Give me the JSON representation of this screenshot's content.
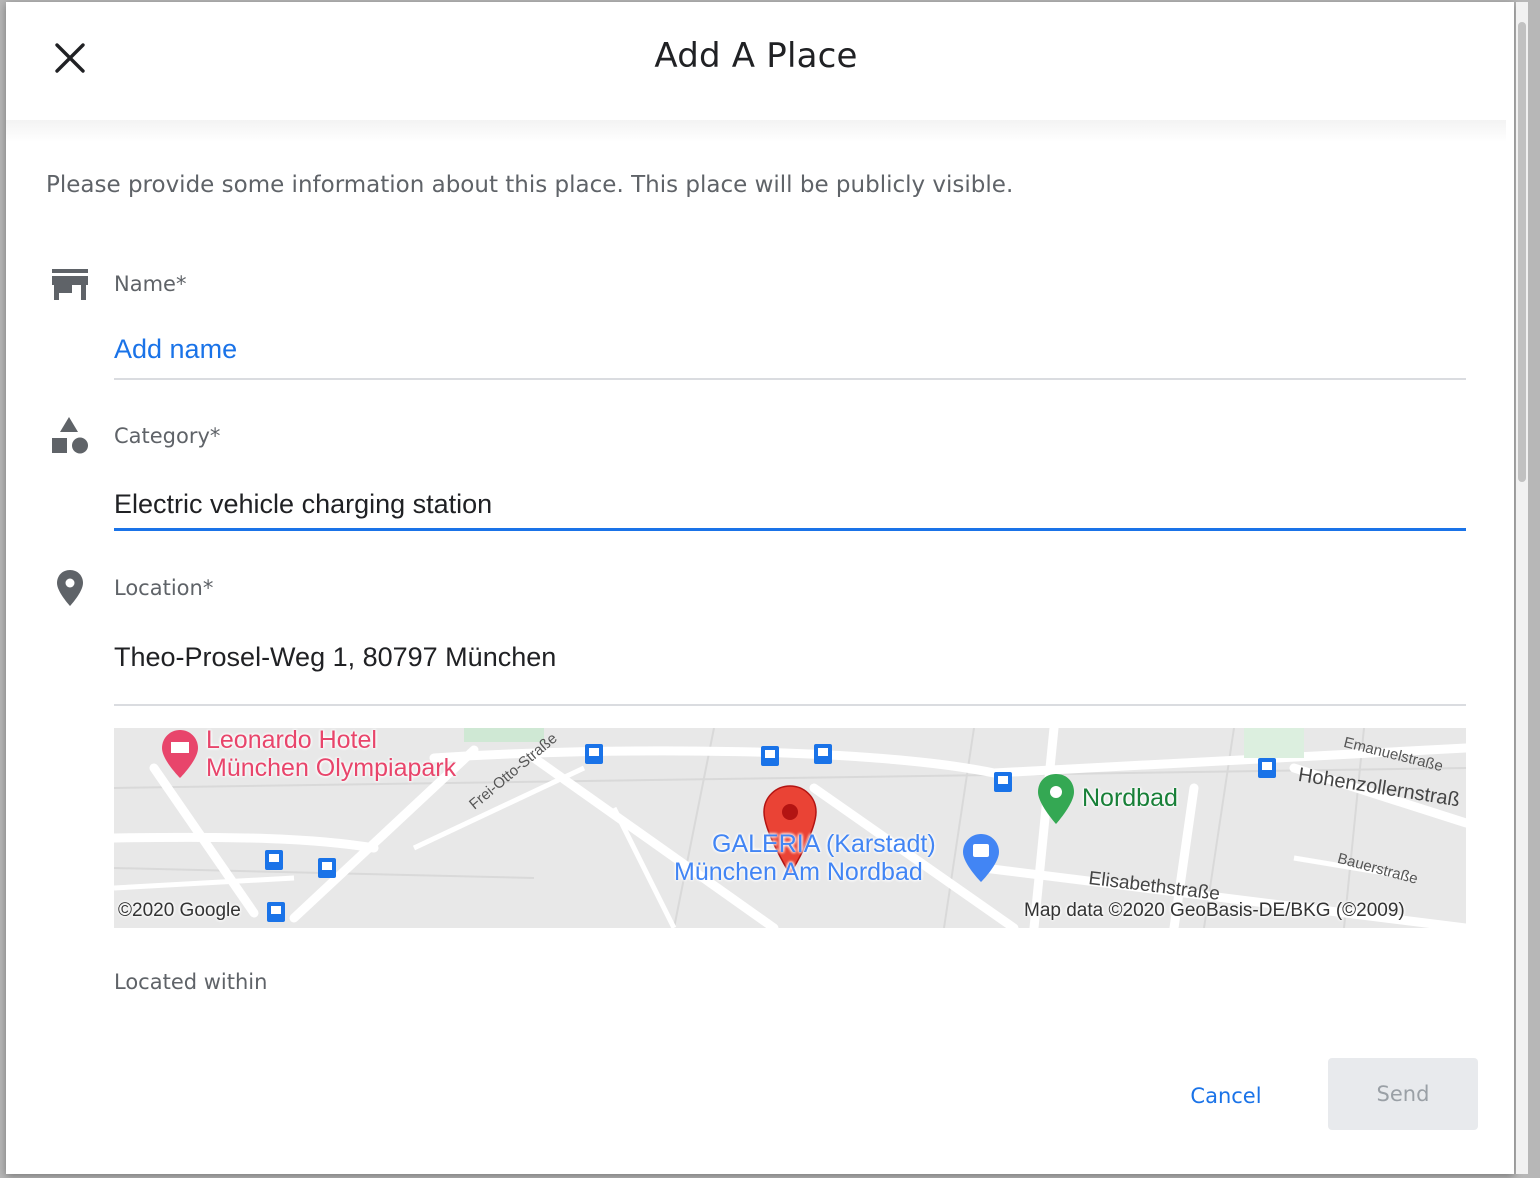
{
  "dialog": {
    "title": "Add A Place",
    "intro": "Please provide some information about this place. This place will be publicly visible."
  },
  "fields": {
    "name": {
      "label": "Name*",
      "placeholder": "Add name",
      "icon": "storefront-icon"
    },
    "category": {
      "label": "Category*",
      "value": "Electric vehicle charging station",
      "icon": "category-shapes-icon"
    },
    "location": {
      "label": "Location*",
      "value": "Theo-Prosel-Weg 1, 80797 München",
      "icon": "location-pin-icon"
    }
  },
  "map": {
    "hotel_line1": "Leonardo Hotel",
    "hotel_line2": "München Olympiapark",
    "store_line1": "GALERIA (Karstadt)",
    "store_line2": "München Am Nordbad",
    "park": "Nordbad",
    "street_freiotto": "Frei-Otto-Straße",
    "street_emanuel": "Emanuelstraße",
    "street_hohenzollern": "Hohenzollernstraß",
    "street_bauer": "Bauerstraße",
    "street_elisabeth": "Elisabethstraße",
    "copyright": "©2020 Google",
    "attribution": "Map data ©2020 GeoBasis-DE/BKG (©2009)",
    "colors": {
      "hotel": "#e8456b",
      "store": "#4285f4",
      "park": "#188038",
      "pin": "#ea4335"
    }
  },
  "located_within": "Located within",
  "buttons": {
    "cancel": "Cancel",
    "send": "Send"
  }
}
